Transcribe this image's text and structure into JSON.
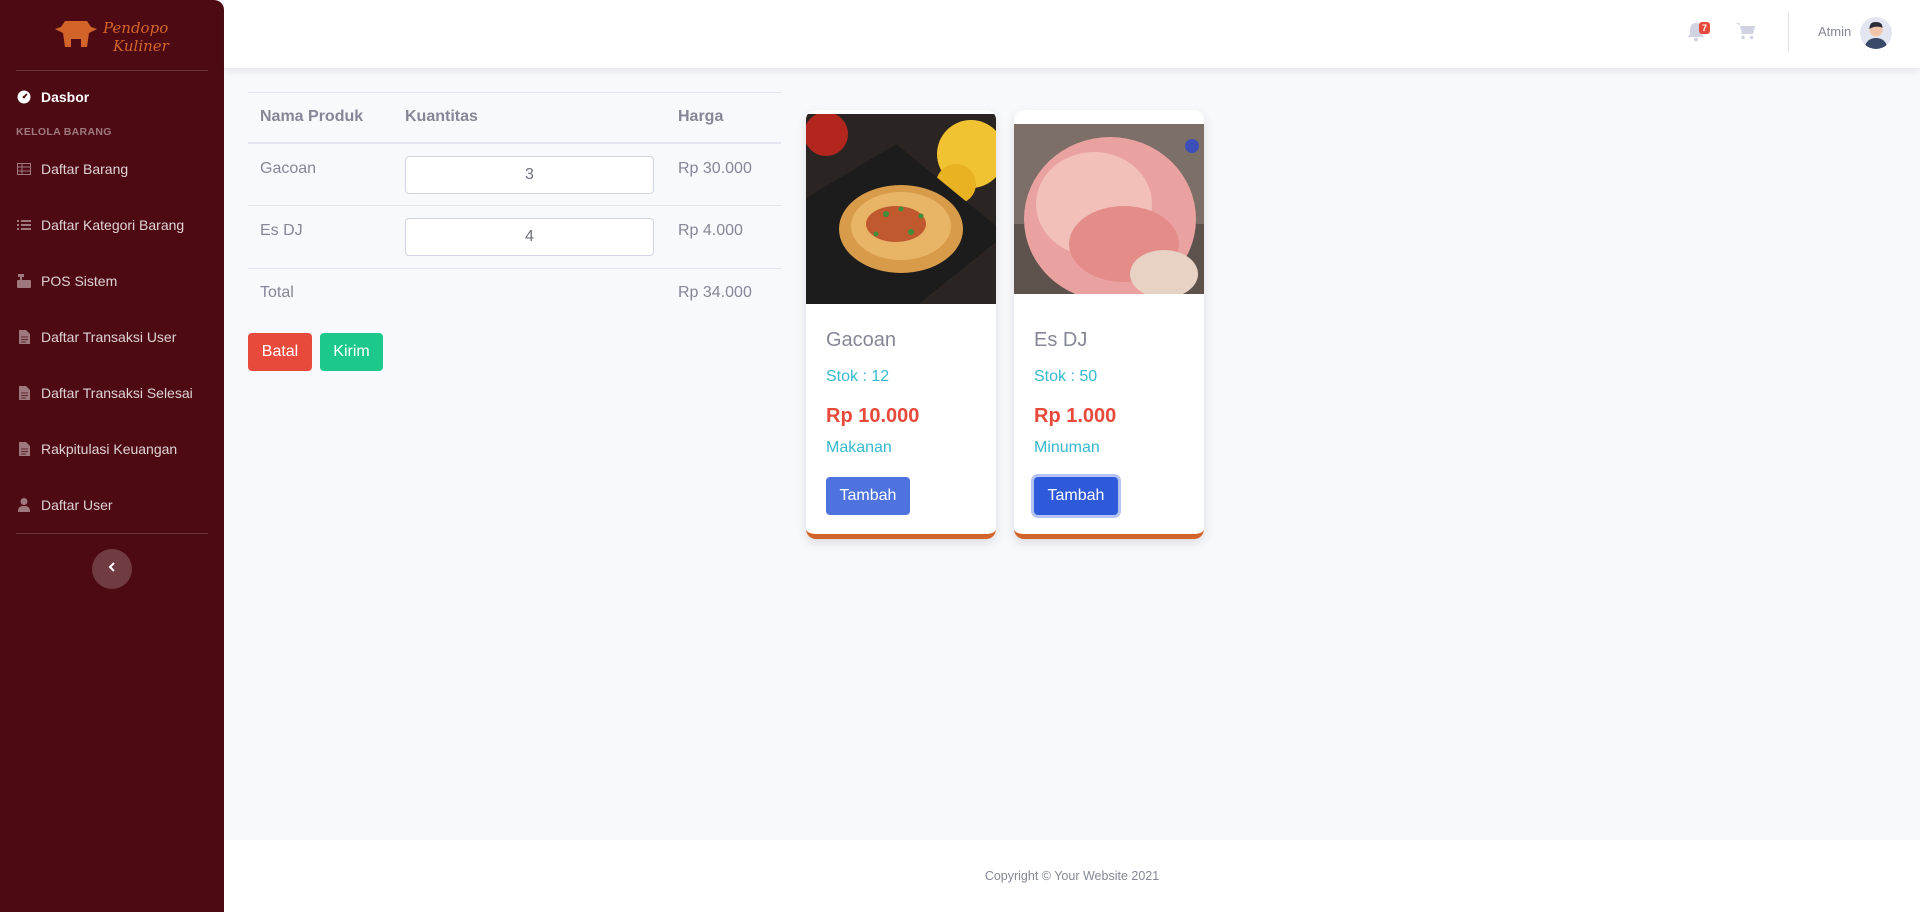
{
  "brand": {
    "line1": "Pendopo",
    "line2": "Kuliner"
  },
  "sidebar": {
    "dashboard": {
      "label": "Dasbor",
      "icon": "tachometer-icon"
    },
    "heading": "KELOLA BARANG",
    "items": [
      {
        "label": "Daftar Barang",
        "icon": "table-icon"
      },
      {
        "label": "Daftar Kategori Barang",
        "icon": "list-icon"
      },
      {
        "label": "POS Sistem",
        "icon": "cash-register-icon"
      },
      {
        "label": "Daftar Transaksi User",
        "icon": "file-icon"
      },
      {
        "label": "Daftar Transaksi Selesai",
        "icon": "file-icon"
      },
      {
        "label": "Rakpitulasi Keuangan",
        "icon": "file-icon"
      },
      {
        "label": "Daftar User",
        "icon": "user-icon"
      }
    ]
  },
  "topbar": {
    "notification_count": "7",
    "user_name": "Atmin"
  },
  "cart": {
    "headers": [
      "Nama Produk",
      "Kuantitas",
      "Harga"
    ],
    "rows": [
      {
        "name": "Gacoan",
        "qty": "3",
        "price": "Rp 30.000"
      },
      {
        "name": "Es DJ",
        "qty": "4",
        "price": "Rp 4.000"
      }
    ],
    "total_label": "Total",
    "total_value": "Rp 34.000",
    "cancel_label": "Batal",
    "submit_label": "Kirim"
  },
  "products": [
    {
      "name": "Gacoan",
      "stock": "Stok : 12",
      "price": "Rp 10.000",
      "category": "Makanan",
      "button": "Tambah"
    },
    {
      "name": "Es DJ",
      "stock": "Stok : 50",
      "price": "Rp 1.000",
      "category": "Minuman",
      "button": "Tambah"
    }
  ],
  "footer": {
    "copyright": "Copyright © Your Website 2021"
  },
  "colors": {
    "sidebar": "#4d0a12",
    "accent": "#4e73df",
    "danger": "#e74a3b",
    "success": "#1cc88a",
    "info": "#36b9cc",
    "card_border": "#d2642a"
  }
}
